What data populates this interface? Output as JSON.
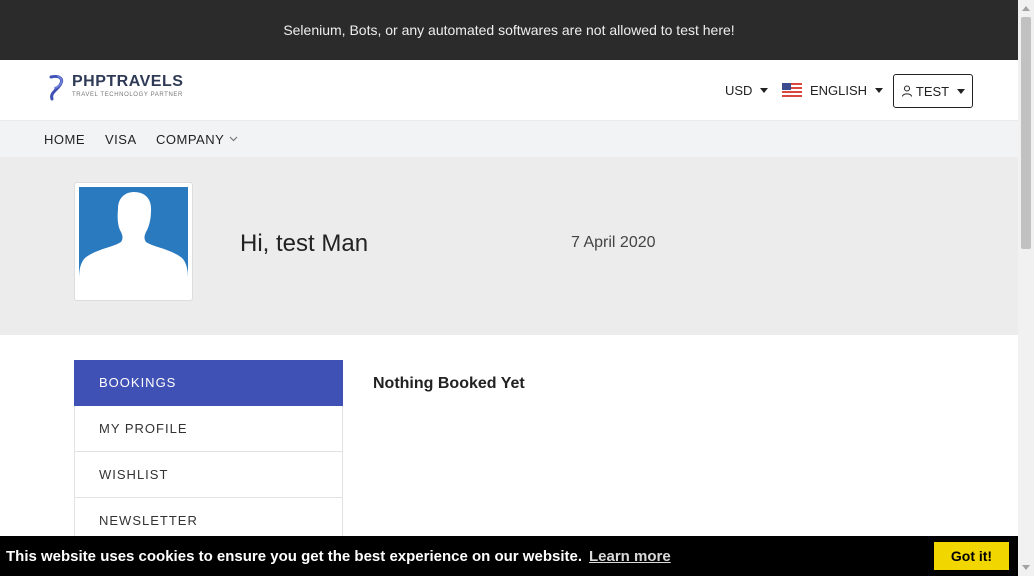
{
  "topbar": {
    "notice": "Selenium, Bots, or any automated softwares are not allowed to test here!"
  },
  "header": {
    "logo_name": "PHPTRAVELS",
    "logo_tagline": "TRAVEL TECHNOLOGY PARTNER",
    "currency": "USD",
    "language": "ENGLISH",
    "user_label": "TEST"
  },
  "nav": {
    "items": [
      "HOME",
      "VISA",
      "COMPANY"
    ]
  },
  "profile": {
    "greeting": "Hi, test Man",
    "date": "7 April 2020"
  },
  "sidebar": {
    "items": [
      "BOOKINGS",
      "MY PROFILE",
      "WISHLIST",
      "NEWSLETTER"
    ],
    "active": "BOOKINGS"
  },
  "main": {
    "empty_message": "Nothing Booked Yet"
  },
  "cookie": {
    "message": "This website uses cookies to ensure you get the best experience on our website.",
    "link_label": "Learn more",
    "button_label": "Got it!"
  },
  "icons": {
    "logo": "phptravels-logo-icon",
    "flag": "us-flag-icon",
    "user": "user-icon",
    "caret": "caret-down-icon",
    "chevron": "chevron-down-icon",
    "avatar": "avatar-placeholder-icon"
  },
  "colors": {
    "topbar_bg": "#2b2b2b",
    "accent": "#3f51b5",
    "cookie_button": "#f1d600"
  }
}
